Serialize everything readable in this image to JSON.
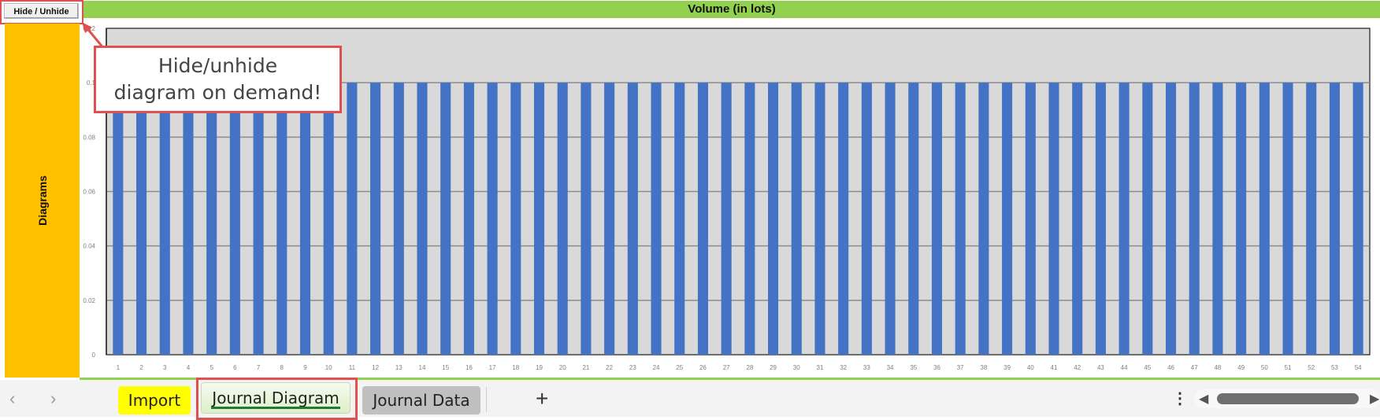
{
  "toolbar": {
    "hide_unhide_label": "Hide / Unhide"
  },
  "sidebar": {
    "label": "Diagrams",
    "color": "#ffc000"
  },
  "annotation": {
    "line1": "Hide/unhide",
    "line2": "diagram on demand!"
  },
  "chart_data": {
    "type": "bar",
    "title": "Volume  (in lots)",
    "xlabel": "",
    "ylabel": "",
    "ylim": [
      0,
      0.12
    ],
    "yticks": [
      "0",
      "0.02",
      "0.04",
      "0.06",
      "0.08",
      "0.1",
      "0.12"
    ],
    "ytick_values": [
      0,
      0.02,
      0.04,
      0.06,
      0.08,
      0.1,
      0.12
    ],
    "grid": true,
    "legend": "none",
    "bar_color": "#4472c4",
    "plot_background": "#d9d9d9",
    "title_background": "#92d050",
    "categories": [
      "1",
      "2",
      "3",
      "4",
      "5",
      "6",
      "7",
      "8",
      "9",
      "10",
      "11",
      "12",
      "13",
      "14",
      "15",
      "16",
      "17",
      "18",
      "19",
      "20",
      "21",
      "22",
      "23",
      "24",
      "25",
      "26",
      "27",
      "28",
      "29",
      "30",
      "31",
      "32",
      "33",
      "34",
      "35",
      "36",
      "37",
      "38",
      "39",
      "40",
      "41",
      "42",
      "43",
      "44",
      "45",
      "46",
      "47",
      "48",
      "49",
      "50",
      "51",
      "52",
      "53",
      "54"
    ],
    "values": [
      0.1,
      0.1,
      0.1,
      0.1,
      0.1,
      0.1,
      0.1,
      0.1,
      0.1,
      0.1,
      0.1,
      0.1,
      0.1,
      0.1,
      0.1,
      0.1,
      0.1,
      0.1,
      0.1,
      0.1,
      0.1,
      0.1,
      0.1,
      0.1,
      0.1,
      0.1,
      0.1,
      0.1,
      0.1,
      0.1,
      0.1,
      0.1,
      0.1,
      0.1,
      0.1,
      0.1,
      0.1,
      0.1,
      0.1,
      0.1,
      0.1,
      0.1,
      0.1,
      0.1,
      0.1,
      0.1,
      0.1,
      0.1,
      0.1,
      0.1,
      0.1,
      0.1,
      0.1,
      0.1
    ]
  },
  "sheet_tabs": {
    "prev_icon": "‹",
    "next_icon": "›",
    "tabs": [
      {
        "label": "Import",
        "color": "#ffff00",
        "active": false
      },
      {
        "label": "Journal Diagram",
        "color": "#e2f0d9",
        "active": true
      },
      {
        "label": "Journal Data",
        "color": "#c0c0c0",
        "active": false
      }
    ],
    "add_icon": "+",
    "more_icon": "⋮"
  }
}
